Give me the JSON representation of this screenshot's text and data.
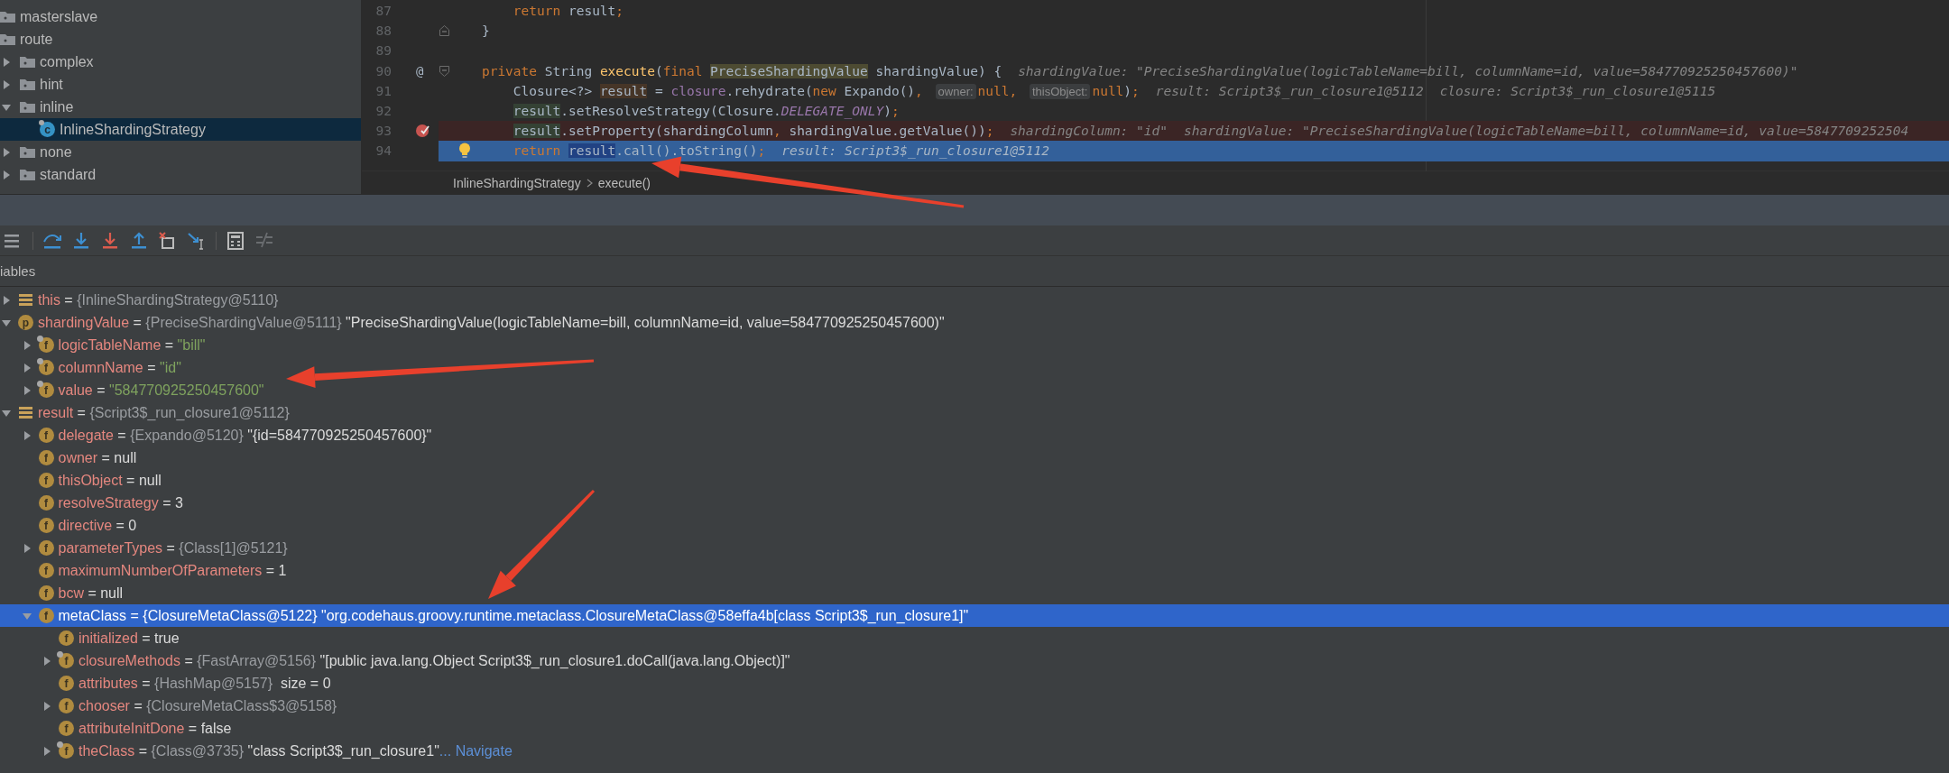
{
  "project_tree": {
    "items": [
      {
        "label": "masterslave",
        "icon": {
          "kind": "folder"
        },
        "selected": false
      },
      {
        "label": "route",
        "icon": {
          "kind": "folder"
        },
        "selected": false,
        "children": [
          {
            "label": "complex",
            "icon": {
              "kind": "folder"
            },
            "expanded": false,
            "selected": false
          },
          {
            "label": "hint",
            "icon": {
              "kind": "folder"
            },
            "expanded": false,
            "selected": false
          },
          {
            "label": "inline",
            "icon": {
              "kind": "folder"
            },
            "expanded": true,
            "selected": false,
            "children": [
              {
                "label": "InlineShardingStrategy",
                "icon": {
                  "kind": "class",
                  "letter": "c"
                },
                "selected": true
              }
            ]
          },
          {
            "label": "none",
            "icon": {
              "kind": "folder"
            },
            "expanded": false,
            "selected": false
          },
          {
            "label": "standard",
            "icon": {
              "kind": "folder"
            },
            "expanded": false,
            "selected": false
          }
        ]
      }
    ]
  },
  "editor": {
    "lines": [
      {
        "number": "87",
        "kind": "normal",
        "code": [
          {
            "kind": "kw",
            "text": "        return "
          },
          {
            "kind": "plain",
            "text": "result"
          },
          {
            "kind": "punct",
            "text": ";"
          }
        ]
      },
      {
        "number": "88",
        "kind": "normal",
        "gutter": [
          {
            "kind": "fold_end"
          }
        ],
        "code": [
          {
            "kind": "plain",
            "text": "    }"
          }
        ]
      },
      {
        "number": "89",
        "kind": "normal"
      },
      {
        "number": "90",
        "kind": "normal",
        "gutter": [
          {
            "kind": "annotation",
            "glyph": "@"
          },
          {
            "kind": "fold_start"
          }
        ],
        "code": [
          {
            "kind": "kw",
            "text": "    private "
          },
          {
            "kind": "plain",
            "text": "String "
          },
          {
            "kind": "decl",
            "text": "execute"
          },
          {
            "kind": "plain",
            "text": "("
          },
          {
            "kind": "kw",
            "text": "final "
          },
          {
            "kind": "type_usage",
            "text": "PreciseShardingValue"
          },
          {
            "kind": "plain",
            "text": " shardingValue) {"
          }
        ],
        "values": [
          "shardingValue: \"PreciseShardingValue(logicTableName=bill, columnName=id, value=584770925250457600)\""
        ]
      },
      {
        "number": "91",
        "kind": "normal",
        "code": [
          {
            "kind": "plain",
            "text": "        Closure<?> "
          },
          {
            "kind": "var_write",
            "text": "result"
          },
          {
            "kind": "plain",
            "text": " = "
          },
          {
            "kind": "field",
            "text": "closure"
          },
          {
            "kind": "plain",
            "text": ".rehydrate("
          },
          {
            "kind": "kw",
            "text": "new "
          },
          {
            "kind": "plain",
            "text": "Expando()"
          },
          {
            "kind": "punct",
            "text": ", "
          },
          {
            "kind": "hint",
            "text": "owner:"
          },
          {
            "kind": "kw",
            "text": "null"
          },
          {
            "kind": "punct",
            "text": ", "
          },
          {
            "kind": "hint",
            "text": "thisObject:"
          },
          {
            "kind": "kw",
            "text": "null"
          },
          {
            "kind": "plain",
            "text": ")"
          },
          {
            "kind": "punct",
            "text": ";"
          }
        ],
        "values": [
          "result: Script3$_run_closure1@5112",
          "closure: Script3$_run_closure1@5115"
        ]
      },
      {
        "number": "92",
        "kind": "normal",
        "code": [
          {
            "kind": "var_read",
            "text": "        result"
          },
          {
            "kind": "plain",
            "text": ".setResolveStrategy(Closure."
          },
          {
            "kind": "static",
            "text": "DELEGATE_ONLY"
          },
          {
            "kind": "plain",
            "text": ")"
          },
          {
            "kind": "punct",
            "text": ";"
          }
        ]
      },
      {
        "number": "93",
        "kind": "breakpoint",
        "gutter": [
          {
            "kind": "breakpoint"
          }
        ],
        "code": [
          {
            "kind": "var_read",
            "text": "        result"
          },
          {
            "kind": "plain",
            "text": ".setProperty(shardingColumn"
          },
          {
            "kind": "punct",
            "text": ", "
          },
          {
            "kind": "plain",
            "text": "shardingValue.getValue())"
          },
          {
            "kind": "punct",
            "text": ";"
          }
        ],
        "values": [
          "shardingColumn: \"id\"",
          "shardingValue: \"PreciseShardingValue(logicTableName=bill, columnName=id, value=5847709252504"
        ]
      },
      {
        "number": "94",
        "kind": "execution",
        "gutter": [
          {
            "kind": "bulb"
          }
        ],
        "code": [
          {
            "kind": "kw",
            "text": "        return "
          },
          {
            "kind": "var_current",
            "text": "result"
          },
          {
            "kind": "plain",
            "text": ".call().toString()"
          },
          {
            "kind": "punct",
            "text": ";"
          }
        ],
        "values": [
          "result: Script3$_run_closure1@5112"
        ]
      }
    ]
  },
  "breadcrumbs": [
    "InlineShardingStrategy",
    "execute()"
  ],
  "debugger": {
    "panel_title": "iables",
    "variables": [
      {
        "name": "this",
        "icon": {
          "kind": "local"
        },
        "eq": "=",
        "type": "{InlineShardingStrategy@5110}",
        "expanded": false,
        "selected": false
      },
      {
        "name": "shardingValue",
        "icon": {
          "kind": "param",
          "letter": "p"
        },
        "eq": "=",
        "type": "{PreciseShardingValue@5111}",
        "value": "\"PreciseShardingValue(logicTableName=bill, columnName=id, value=584770925250457600)\"",
        "string": false,
        "expanded": true,
        "selected": false,
        "children": [
          {
            "name": "logicTableName",
            "icon": {
              "kind": "field",
              "letter": "f",
              "final": true
            },
            "eq": "=",
            "value": "\"bill\"",
            "string": true,
            "expanded": false,
            "selected": false
          },
          {
            "name": "columnName",
            "icon": {
              "kind": "field",
              "letter": "f",
              "final": true
            },
            "eq": "=",
            "value": "\"id\"",
            "string": true,
            "expanded": false,
            "selected": false
          },
          {
            "name": "value",
            "icon": {
              "kind": "field",
              "letter": "f",
              "final": true
            },
            "eq": "=",
            "value": "\"584770925250457600\"",
            "string": true,
            "expanded": false,
            "selected": false
          }
        ]
      },
      {
        "name": "result",
        "icon": {
          "kind": "local"
        },
        "eq": "=",
        "type": "{Script3$_run_closure1@5112}",
        "expanded": true,
        "selected": false,
        "children": [
          {
            "name": "delegate",
            "icon": {
              "kind": "field",
              "letter": "f",
              "final": false
            },
            "eq": "=",
            "type": "{Expando@5120}",
            "value": "\"{id=584770925250457600}\"",
            "string": false,
            "expanded": false,
            "selected": false
          },
          {
            "name": "owner",
            "icon": {
              "kind": "field",
              "letter": "f",
              "final": false
            },
            "eq": "=",
            "value": "null",
            "string": false,
            "selected": false
          },
          {
            "name": "thisObject",
            "icon": {
              "kind": "field",
              "letter": "f",
              "final": false
            },
            "eq": "=",
            "value": "null",
            "string": false,
            "selected": false
          },
          {
            "name": "resolveStrategy",
            "icon": {
              "kind": "field",
              "letter": "f",
              "final": false
            },
            "eq": "=",
            "value": "3",
            "string": false,
            "selected": false
          },
          {
            "name": "directive",
            "icon": {
              "kind": "field",
              "letter": "f",
              "final": false
            },
            "eq": "=",
            "value": "0",
            "string": false,
            "selected": false
          },
          {
            "name": "parameterTypes",
            "icon": {
              "kind": "field",
              "letter": "f",
              "final": false
            },
            "eq": "=",
            "type": "{Class[1]@5121}",
            "expanded": false,
            "selected": false
          },
          {
            "name": "maximumNumberOfParameters",
            "icon": {
              "kind": "field",
              "letter": "f",
              "final": false
            },
            "eq": "=",
            "value": "1",
            "string": false,
            "selected": false
          },
          {
            "name": "bcw",
            "icon": {
              "kind": "field",
              "letter": "f",
              "final": false
            },
            "eq": "=",
            "value": "null",
            "string": false,
            "selected": false
          },
          {
            "name": "metaClass",
            "icon": {
              "kind": "field",
              "letter": "f",
              "final": false
            },
            "eq": "=",
            "type": "{ClosureMetaClass@5122}",
            "value": "\"org.codehaus.groovy.runtime.metaclass.ClosureMetaClass@58effa4b[class Script3$_run_closure1]\"",
            "string": false,
            "expanded": true,
            "selected": true,
            "children": [
              {
                "name": "initialized",
                "icon": {
                  "kind": "field",
                  "letter": "f",
                  "final": false
                },
                "eq": "=",
                "value": "true",
                "string": false,
                "selected": false
              },
              {
                "name": "closureMethods",
                "icon": {
                  "kind": "field",
                  "letter": "f",
                  "final": true
                },
                "eq": "=",
                "type": "{FastArray@5156}",
                "value": "\"[public java.lang.Object Script3$_run_closure1.doCall(java.lang.Object)]\"",
                "string": false,
                "expanded": false,
                "selected": false
              },
              {
                "name": "attributes",
                "icon": {
                  "kind": "field",
                  "letter": "f",
                  "final": false
                },
                "eq": "=",
                "type": "{HashMap@5157}",
                "value": "size = 0",
                "string": false,
                "selected": false
              },
              {
                "name": "chooser",
                "icon": {
                  "kind": "field",
                  "letter": "f",
                  "final": false
                },
                "eq": "=",
                "type": "{ClosureMetaClass$3@5158}",
                "expanded": false,
                "selected": false
              },
              {
                "name": "attributeInitDone",
                "icon": {
                  "kind": "field",
                  "letter": "f",
                  "final": false
                },
                "eq": "=",
                "value": "false",
                "string": false,
                "selected": false
              },
              {
                "name": "theClass",
                "icon": {
                  "kind": "field",
                  "letter": "f",
                  "final": true
                },
                "eq": "=",
                "type": "{Class@3735}",
                "value": "\"class Script3$_run_closure1\"",
                "string": false,
                "link": "... Navigate",
                "expanded": false,
                "selected": false
              }
            ]
          }
        ]
      }
    ]
  }
}
